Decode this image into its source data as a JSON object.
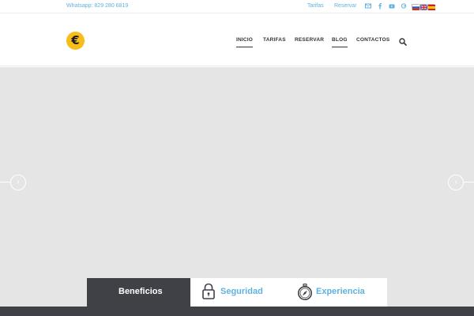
{
  "topbar": {
    "whatsapp": "Whatsapp: 829 280 6819",
    "links": [
      "Tarifas",
      "Reservar"
    ],
    "social_icons": [
      "mail-icon",
      "facebook-icon",
      "youtube-icon",
      "googleplus-icon"
    ],
    "flags": [
      "russian-flag-icon",
      "uk-flag-icon",
      "spanish-flag-icon"
    ]
  },
  "header": {
    "logo_glyph": "€",
    "nav": [
      "INICIO",
      "TARIFAS",
      "RESERVAR",
      "BLOG",
      "CONTACTOS"
    ],
    "active_nav": [
      "INICIO",
      "BLOG"
    ]
  },
  "slider": {
    "prev_glyph": "‹",
    "next_glyph": "›"
  },
  "tabs": {
    "items": [
      {
        "label": "Beneficios",
        "active": true
      },
      {
        "label": "Seguridad",
        "icon": "padlock-icon"
      },
      {
        "label": "Experiencia",
        "icon": "compass-icon"
      }
    ]
  },
  "colors": {
    "accent": "#5fb2dd",
    "logo": "#f7bd1b",
    "dark": "#3f4147",
    "slider_bg": "#e5e5e5"
  }
}
